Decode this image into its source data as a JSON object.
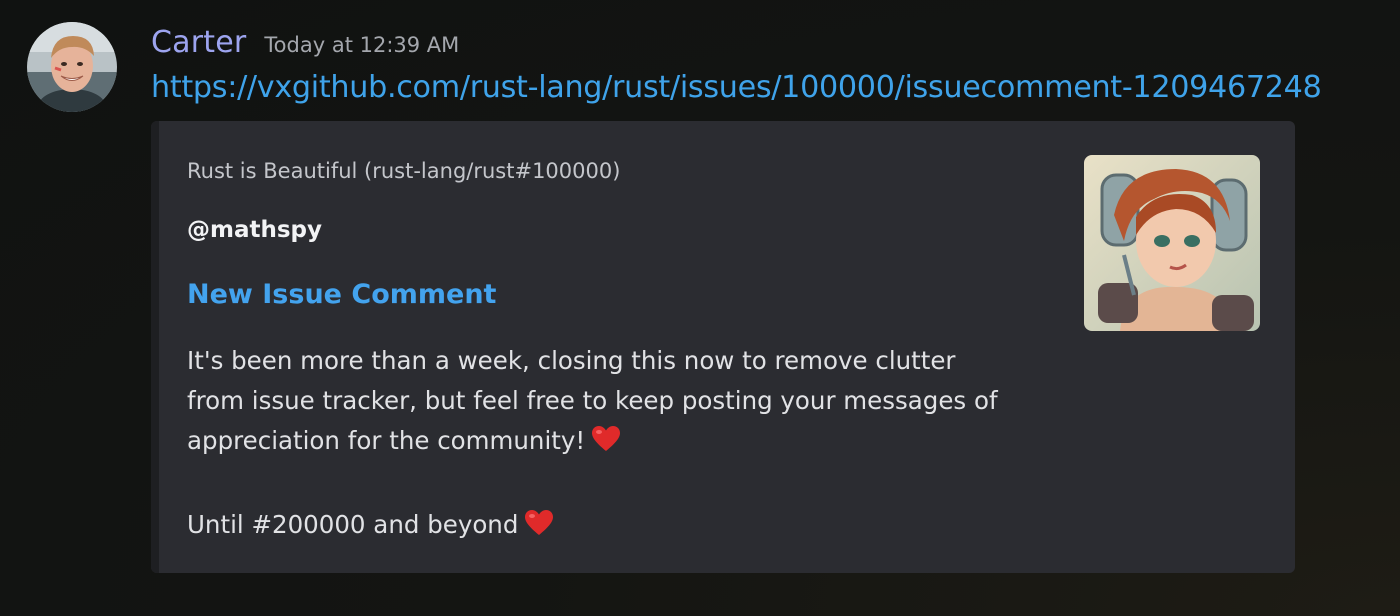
{
  "message": {
    "author": "Carter",
    "timestamp": "Today at 12:39 AM",
    "link_text": "https://vxgithub.com/rust-lang/rust/issues/100000/issuecomment-1209467248",
    "avatar_icon": "user-avatar"
  },
  "embed": {
    "provider": "Rust is Beautiful (rust-lang/rust#100000)",
    "author": "@mathspy",
    "title": "New Issue Comment",
    "description_lines": [
      "It's been more than a week, closing this now to remove clutter",
      "from issue tracker, but feel free to keep posting your messages of",
      "appreciation for the community!",
      "Until #200000 and beyond"
    ],
    "heart_emoji": "❤️",
    "thumbnail_icon": "anime-character-thumbnail",
    "colors": {
      "background": "#2b2c31",
      "title": "#43a3ee",
      "link": "#3fa3ea",
      "username": "#9da4ef"
    }
  }
}
